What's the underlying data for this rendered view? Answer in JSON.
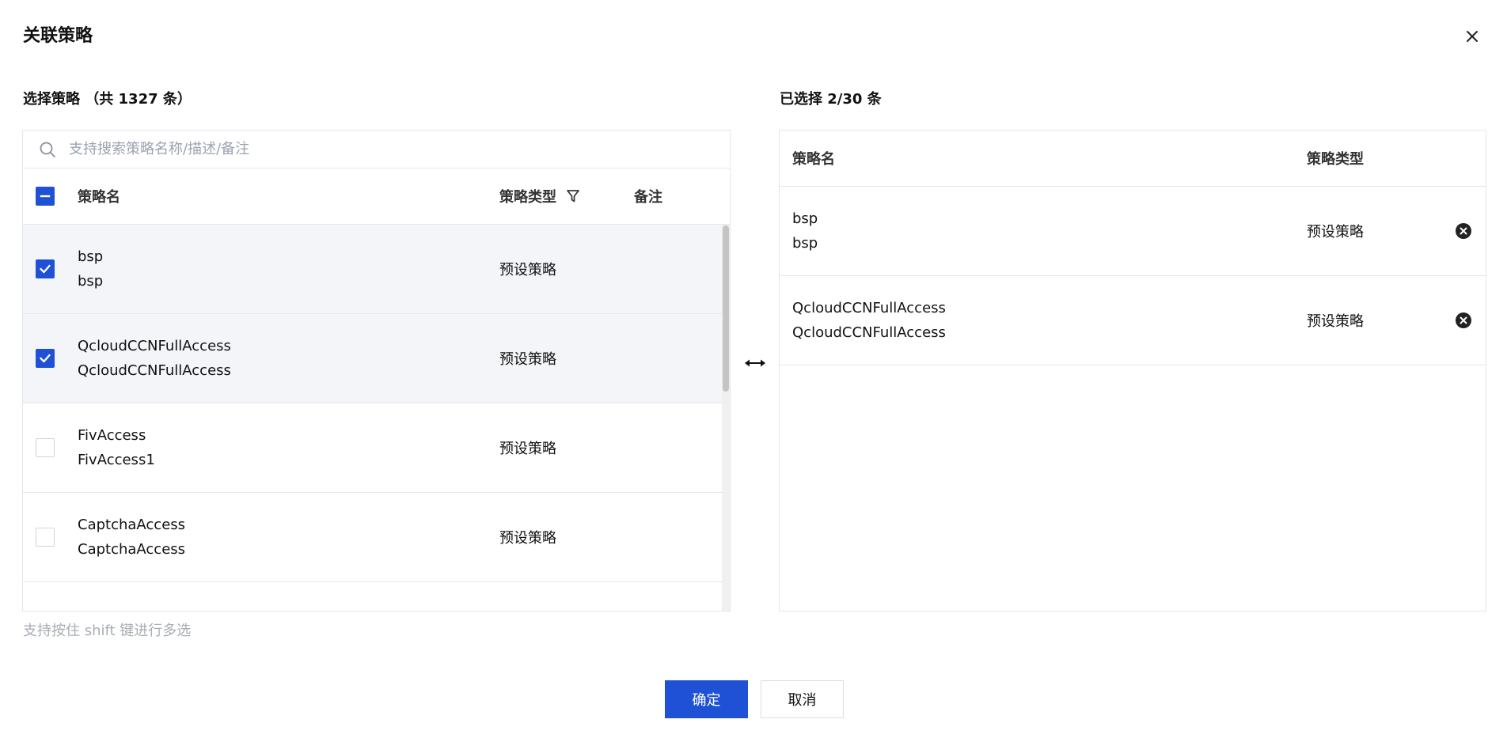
{
  "dialog": {
    "title": "关联策略",
    "close_label": "×"
  },
  "left": {
    "heading": "选择策略 （共 1327 条）",
    "search_placeholder": "支持搜索策略名称/描述/备注",
    "columns": {
      "name": "策略名",
      "type": "策略类型",
      "remark": "备注"
    },
    "select_all_state": "indeterminate",
    "rows": [
      {
        "name": "bsp",
        "desc": "bsp",
        "type": "预设策略",
        "checked": true
      },
      {
        "name": "QcloudCCNFullAccess",
        "desc": "QcloudCCNFullAccess",
        "type": "预设策略",
        "checked": true
      },
      {
        "name": "FivAccess",
        "desc": "FivAccess1",
        "type": "预设策略",
        "checked": false
      },
      {
        "name": "CaptchaAccess",
        "desc": "CaptchaAccess",
        "type": "预设策略",
        "checked": false
      }
    ]
  },
  "right": {
    "heading": "已选择 2/30 条",
    "columns": {
      "name": "策略名",
      "type": "策略类型"
    },
    "rows": [
      {
        "name": "bsp",
        "desc": "bsp",
        "type": "预设策略"
      },
      {
        "name": "QcloudCCNFullAccess",
        "desc": "QcloudCCNFullAccess",
        "type": "预设策略"
      }
    ]
  },
  "hint": "支持按住 shift 键进行多选",
  "buttons": {
    "confirm": "确定",
    "cancel": "取消"
  },
  "colors": {
    "accent": "#1f51d6",
    "selected_row_bg": "#f3f5f8",
    "border": "#e3e6eb"
  }
}
